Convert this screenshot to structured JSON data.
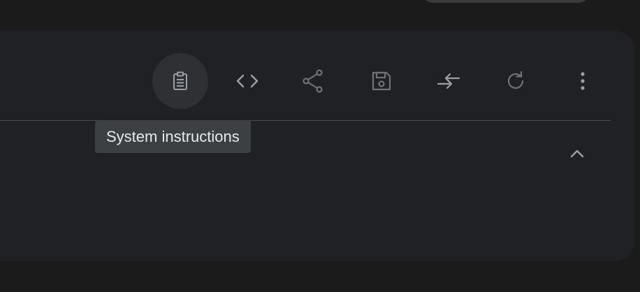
{
  "toolbar": {
    "buttons": [
      {
        "icon": "clipboard-icon",
        "active": true
      },
      {
        "icon": "code-icon",
        "active": false
      },
      {
        "icon": "share-icon",
        "active": false
      },
      {
        "icon": "save-icon",
        "active": false
      },
      {
        "icon": "compare-arrows-icon",
        "active": false
      },
      {
        "icon": "refresh-icon",
        "active": false
      },
      {
        "icon": "more-vert-icon",
        "active": false
      }
    ]
  },
  "tooltip": {
    "text": "System instructions"
  },
  "section": {
    "collapse_icon": "chevron-up-icon"
  },
  "colors": {
    "background": "#1b1b1c",
    "panel": "#202124",
    "icon": "#9aa0a6",
    "tooltip_bg": "#3c4043",
    "tooltip_text": "#e8eaed"
  }
}
